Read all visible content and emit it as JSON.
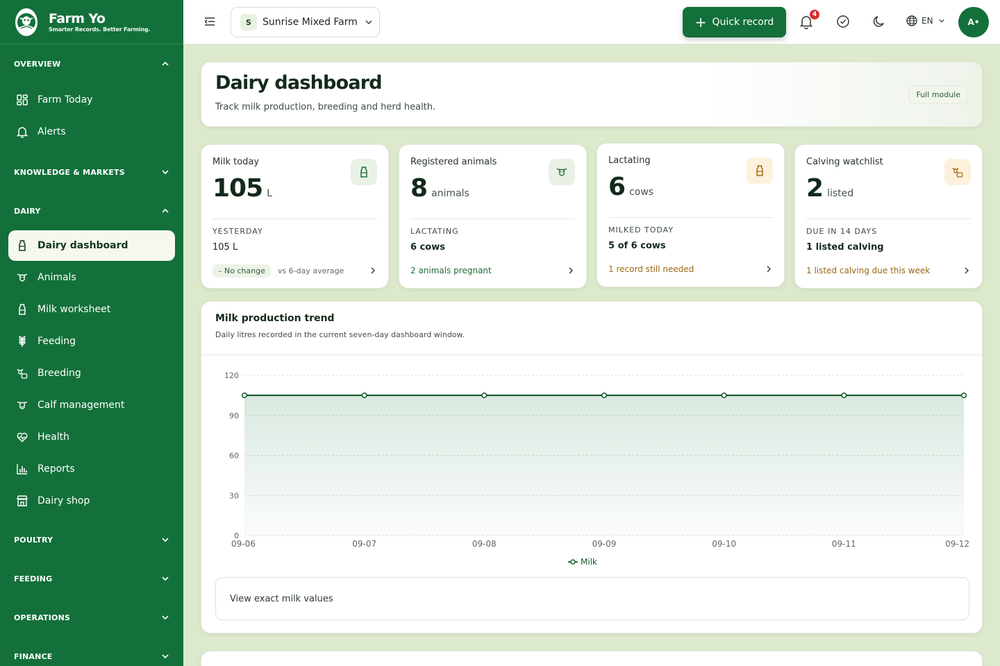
{
  "brand": {
    "name": "Farm Yo",
    "tagline": "Smarter Records. Better Farming."
  },
  "sidebar": {
    "sections": [
      {
        "title": "OVERVIEW",
        "expanded": true
      },
      {
        "title": "KNOWLEDGE & MARKETS",
        "expanded": false
      },
      {
        "title": "DAIRY",
        "expanded": true
      },
      {
        "title": "POULTRY",
        "expanded": false
      },
      {
        "title": "FEEDING",
        "expanded": false
      },
      {
        "title": "OPERATIONS",
        "expanded": false
      },
      {
        "title": "FINANCE",
        "expanded": false
      }
    ],
    "overview_items": [
      {
        "label": "Farm Today",
        "icon": "dashboard-grid-icon"
      },
      {
        "label": "Alerts",
        "icon": "bell-icon"
      }
    ],
    "dairy_items": [
      {
        "label": "Dairy dashboard",
        "icon": "milk-bottle-icon",
        "active": true
      },
      {
        "label": "Animals",
        "icon": "cow-icon"
      },
      {
        "label": "Milk worksheet",
        "icon": "milk-bottle-icon"
      },
      {
        "label": "Feeding",
        "icon": "wheat-icon"
      },
      {
        "label": "Breeding",
        "icon": "breeding-icon"
      },
      {
        "label": "Calf management",
        "icon": "calf-icon"
      },
      {
        "label": "Health",
        "icon": "heart-pulse-icon"
      },
      {
        "label": "Reports",
        "icon": "bar-chart-icon"
      },
      {
        "label": "Dairy shop",
        "icon": "store-icon"
      }
    ]
  },
  "topbar": {
    "farm_initial": "S",
    "farm_name": "Sunrise Mixed Farm",
    "quick_record": "Quick record",
    "notifications_count": "4",
    "language": "EN",
    "avatar": "A•"
  },
  "header": {
    "title": "Dairy dashboard",
    "subtitle": "Track milk production, breeding and herd health.",
    "full_module": "Full module"
  },
  "stats": {
    "milk": {
      "label": "Milk today",
      "value": "105",
      "unit": "L",
      "sub_label": "YESTERDAY",
      "sub_value": "105 L",
      "chip": "– No change",
      "note": "vs 6-day average",
      "icon": "milk-bottle-icon"
    },
    "registered": {
      "label": "Registered animals",
      "value": "8",
      "unit": "animals",
      "sub_label": "LACTATING",
      "sub_value": "6 cows",
      "link": "2 animals pregnant",
      "icon": "cow-icon"
    },
    "lactating": {
      "label": "Lactating",
      "value": "6",
      "unit": "cows",
      "sub_label": "MILKED TODAY",
      "sub_value": "5 of 6 cows",
      "link": "1 record still needed",
      "icon": "milk-bottle-icon"
    },
    "calving": {
      "label": "Calving watchlist",
      "value": "2",
      "unit": "listed",
      "sub_label": "DUE IN 14 DAYS",
      "sub_value": "1 listed calving",
      "link": "1 listed calving due this week",
      "icon": "breeding-icon"
    }
  },
  "trend": {
    "title": "Milk production trend",
    "subtitle": "Daily litres recorded in the current seven-day dashboard window.",
    "view_values": "View exact milk values"
  },
  "colors": {
    "brand_green": "#13703a",
    "background": "#dde9cc",
    "warning": "#9a6812",
    "badge_red": "#d32f2f"
  },
  "chart_data": {
    "type": "area",
    "categories": [
      "09-06",
      "09-07",
      "09-08",
      "09-09",
      "09-10",
      "09-11",
      "09-12"
    ],
    "series": [
      {
        "name": "Milk",
        "values": [
          105,
          105,
          105,
          105,
          105,
          105,
          105
        ]
      }
    ],
    "yticks": [
      0,
      30,
      60,
      90,
      120
    ],
    "ylim": [
      0,
      120
    ],
    "grid": true,
    "legend": "bottom-center"
  }
}
